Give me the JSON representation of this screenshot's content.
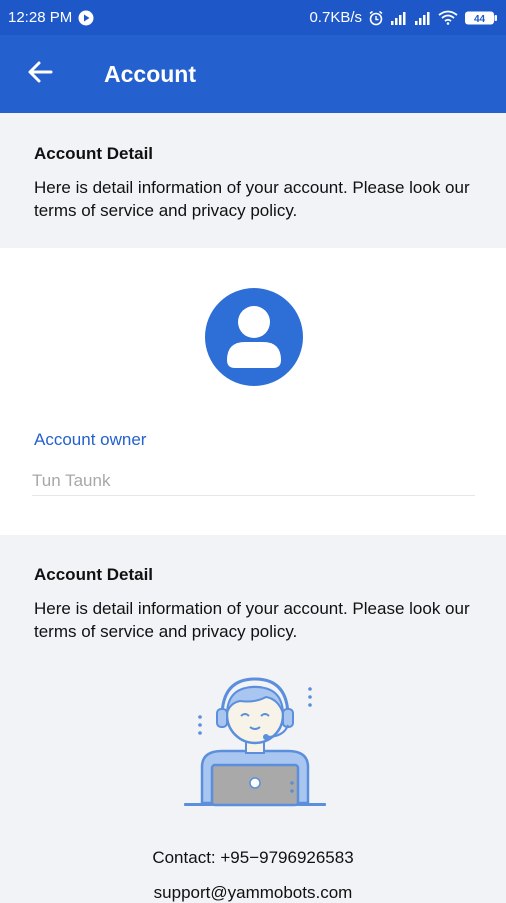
{
  "status_bar": {
    "time": "12:28 PM",
    "speed": "0.7KB/s",
    "battery": "44",
    "icons": [
      "play-circle-icon",
      "alarm-icon",
      "signal-icon",
      "signal-icon",
      "wifi-icon",
      "battery-icon"
    ]
  },
  "app_bar": {
    "title": "Account",
    "back_icon": "arrow-left-icon"
  },
  "section1": {
    "title": "Account Detail",
    "text": "Here is detail information of your account. Please look our terms of service and privacy policy."
  },
  "owner": {
    "avatar_icon": "account-circle-icon",
    "label": "Account owner",
    "value": "Tun Taunk"
  },
  "section2": {
    "title": "Account Detail",
    "text": "Here is detail information of your account. Please look our terms of service and privacy policy.",
    "illustration": "customer-support-icon",
    "contact": "Contact: +95−9796926583",
    "email": "support@yammobots.com"
  },
  "colors": {
    "primary": "#2461cf",
    "status_bar": "#1e57c8",
    "background": "#f1f3f6",
    "illustration": "#8fb3e9"
  }
}
